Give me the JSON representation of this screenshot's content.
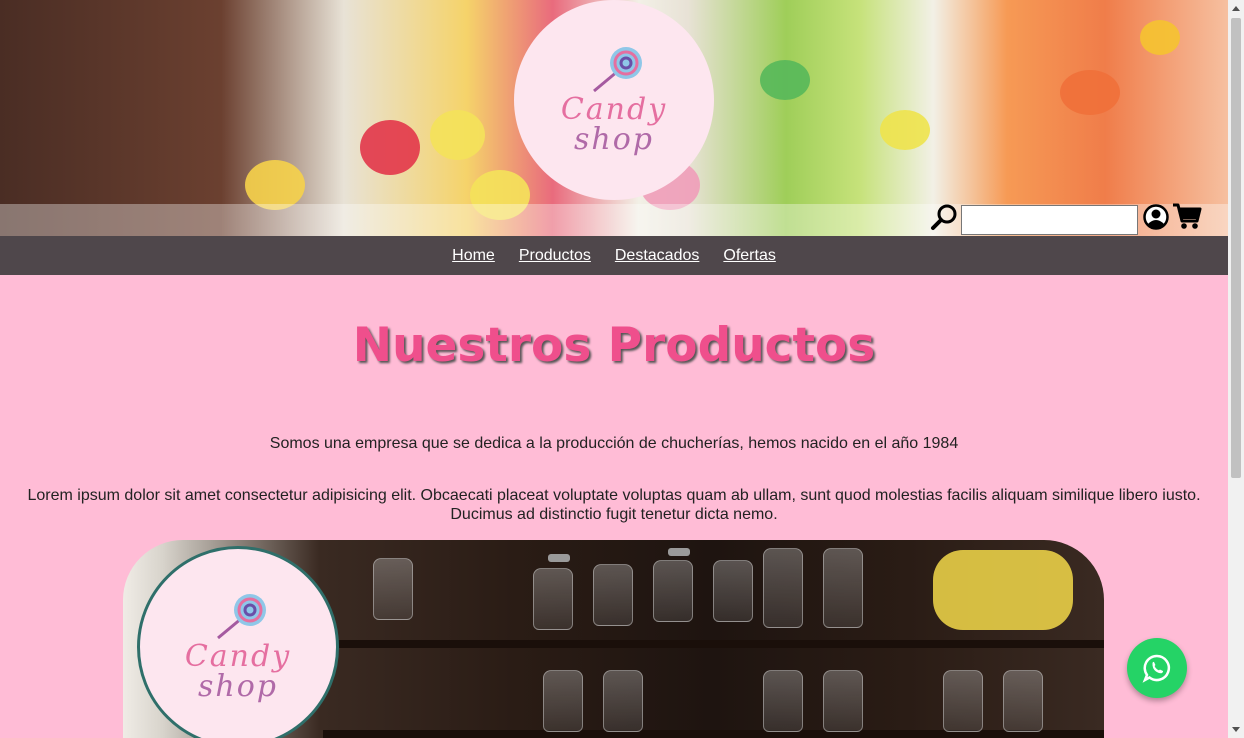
{
  "header": {
    "logo": {
      "line1": "Candy",
      "line2": "shop"
    },
    "search": {
      "value": "",
      "placeholder": ""
    },
    "icons": [
      "search-icon",
      "user-icon",
      "cart-icon"
    ]
  },
  "nav": {
    "items": [
      {
        "label": "Home"
      },
      {
        "label": "Productos"
      },
      {
        "label": "Destacados"
      },
      {
        "label": "Ofertas"
      }
    ]
  },
  "main": {
    "title": "Nuestros Productos",
    "intro": "Somos una empresa que se dedica a la producción de chucherías, hemos nacido en el año 1984",
    "lorem": "Lorem ipsum dolor sit amet consectetur adipisicing elit. Obcaecati placeat voluptate voluptas quam ab ullam, sunt quod molestias facilis aliquam similique libero iusto. Ducimus ad distinctio fugit tenetur dicta nemo.",
    "store_logo": {
      "line1": "Candy",
      "line2": "shop"
    }
  },
  "colors": {
    "page_bg": "#ffbcd6",
    "nav_bg": "#4f474b",
    "title": "#ef4f8c",
    "whatsapp": "#25d366"
  },
  "floating": {
    "icon": "whatsapp-icon"
  }
}
